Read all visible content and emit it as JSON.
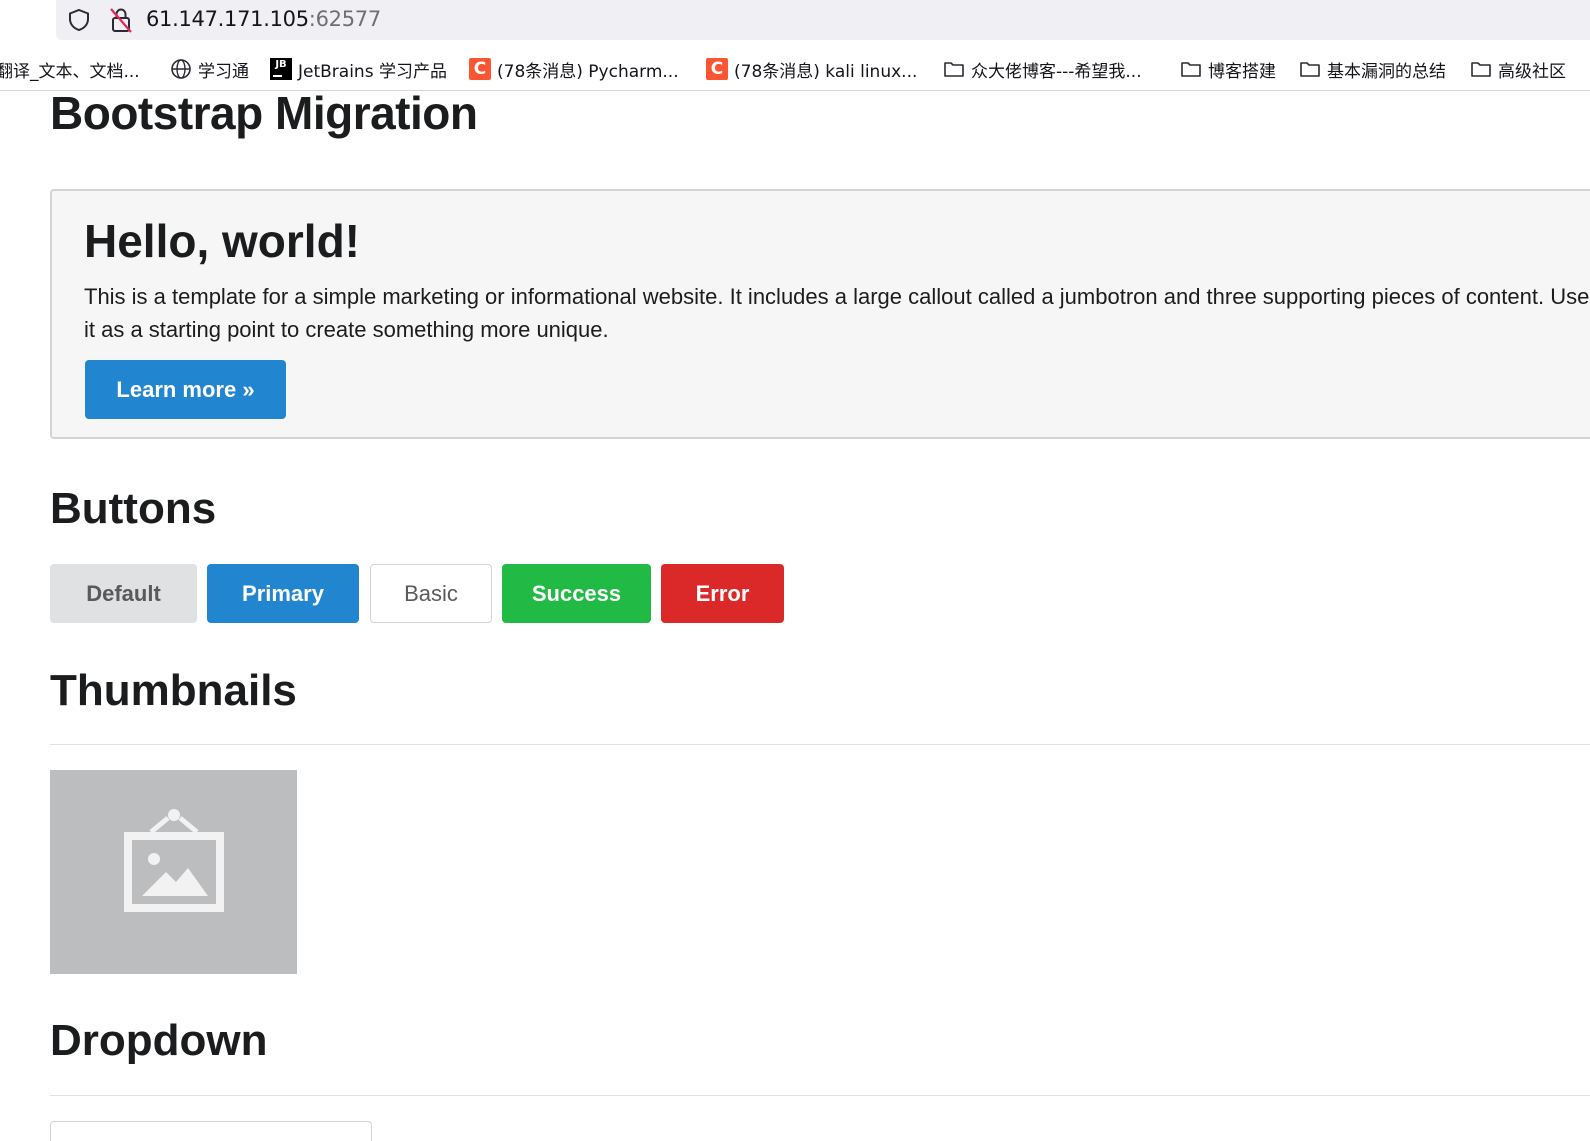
{
  "browser": {
    "url_host": "61.147.171.105",
    "url_port": ":62577",
    "bookmarks": [
      {
        "label": "翻译_文本、文档...",
        "icon": "none"
      },
      {
        "label": "学习通",
        "icon": "globe-icon"
      },
      {
        "label": "JetBrains 学习产品",
        "icon": "jetbrains-icon"
      },
      {
        "label": "(78条消息) Pycharm...",
        "icon": "csdn-icon"
      },
      {
        "label": "(78条消息) kali linux...",
        "icon": "csdn-icon"
      },
      {
        "label": "众大佬博客---希望我...",
        "icon": "folder-icon"
      },
      {
        "label": "博客搭建",
        "icon": "folder-icon"
      },
      {
        "label": "基本漏洞的总结",
        "icon": "folder-icon"
      },
      {
        "label": "高级社区",
        "icon": "folder-icon"
      }
    ],
    "jetbrains_icon_text": "JB",
    "csdn_icon_text": "C"
  },
  "page": {
    "title": "Bootstrap Migration",
    "jumbotron": {
      "heading": "Hello, world!",
      "text": "This is a template for a simple marketing or informational website. It includes a large callout called a jumbotron and three supporting pieces of content. Use it as a starting point to create something more unique.",
      "button_label": "Learn more »"
    },
    "buttons_section": {
      "heading": "Buttons",
      "default_label": "Default",
      "primary_label": "Primary",
      "basic_label": "Basic",
      "success_label": "Success",
      "error_label": "Error"
    },
    "thumbnails_section": {
      "heading": "Thumbnails",
      "image_icon": "image-placeholder-icon"
    },
    "dropdown_section": {
      "heading": "Dropdown"
    }
  },
  "colors": {
    "primary": "#2185d0",
    "success": "#21ba45",
    "error": "#db2828",
    "default": "#e0e1e2"
  }
}
